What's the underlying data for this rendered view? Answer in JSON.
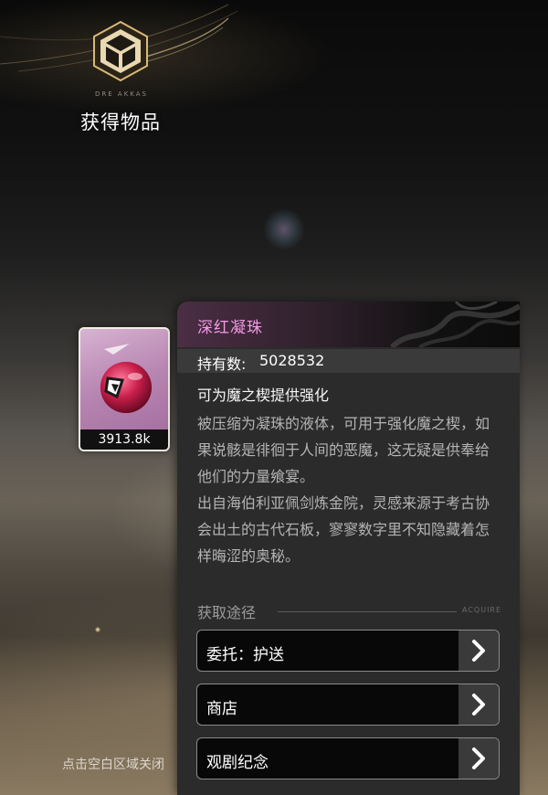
{
  "header": {
    "emblem_caption": "DRE AKKAS",
    "title": "获得物品",
    "emblem_icon": "box-emblem-icon"
  },
  "item_card": {
    "count": "3913.8k",
    "icon": "crimson-orb-icon",
    "rarity_color": "#b886b2"
  },
  "detail": {
    "name": "深红凝珠",
    "name_color": "#f39be6",
    "hold_label": "持有数:",
    "hold_value": "5028532",
    "effect": "可为魔之楔提供强化",
    "description_1": "被压缩为凝珠的液体，可用于强化魔之楔，如果说骸是徘徊于人间的恶魔，这无疑是供奉给他们的力量飨宴。",
    "description_2": "出自海伯利亚佩剑炼金院，灵感来源于考古协会出土的古代石板，寥寥数字里不知隐藏着怎样晦涩的奥秘。",
    "source_title": "获取途径",
    "source_tag": "ACQUIRE",
    "sources": [
      {
        "label": "委托：护送",
        "icon": "chevron-right-icon"
      },
      {
        "label": "商店",
        "icon": "chevron-right-icon"
      },
      {
        "label": "观剧纪念",
        "icon": "chevron-right-icon"
      }
    ]
  },
  "footer": {
    "hint": "点击空白区域关闭"
  }
}
